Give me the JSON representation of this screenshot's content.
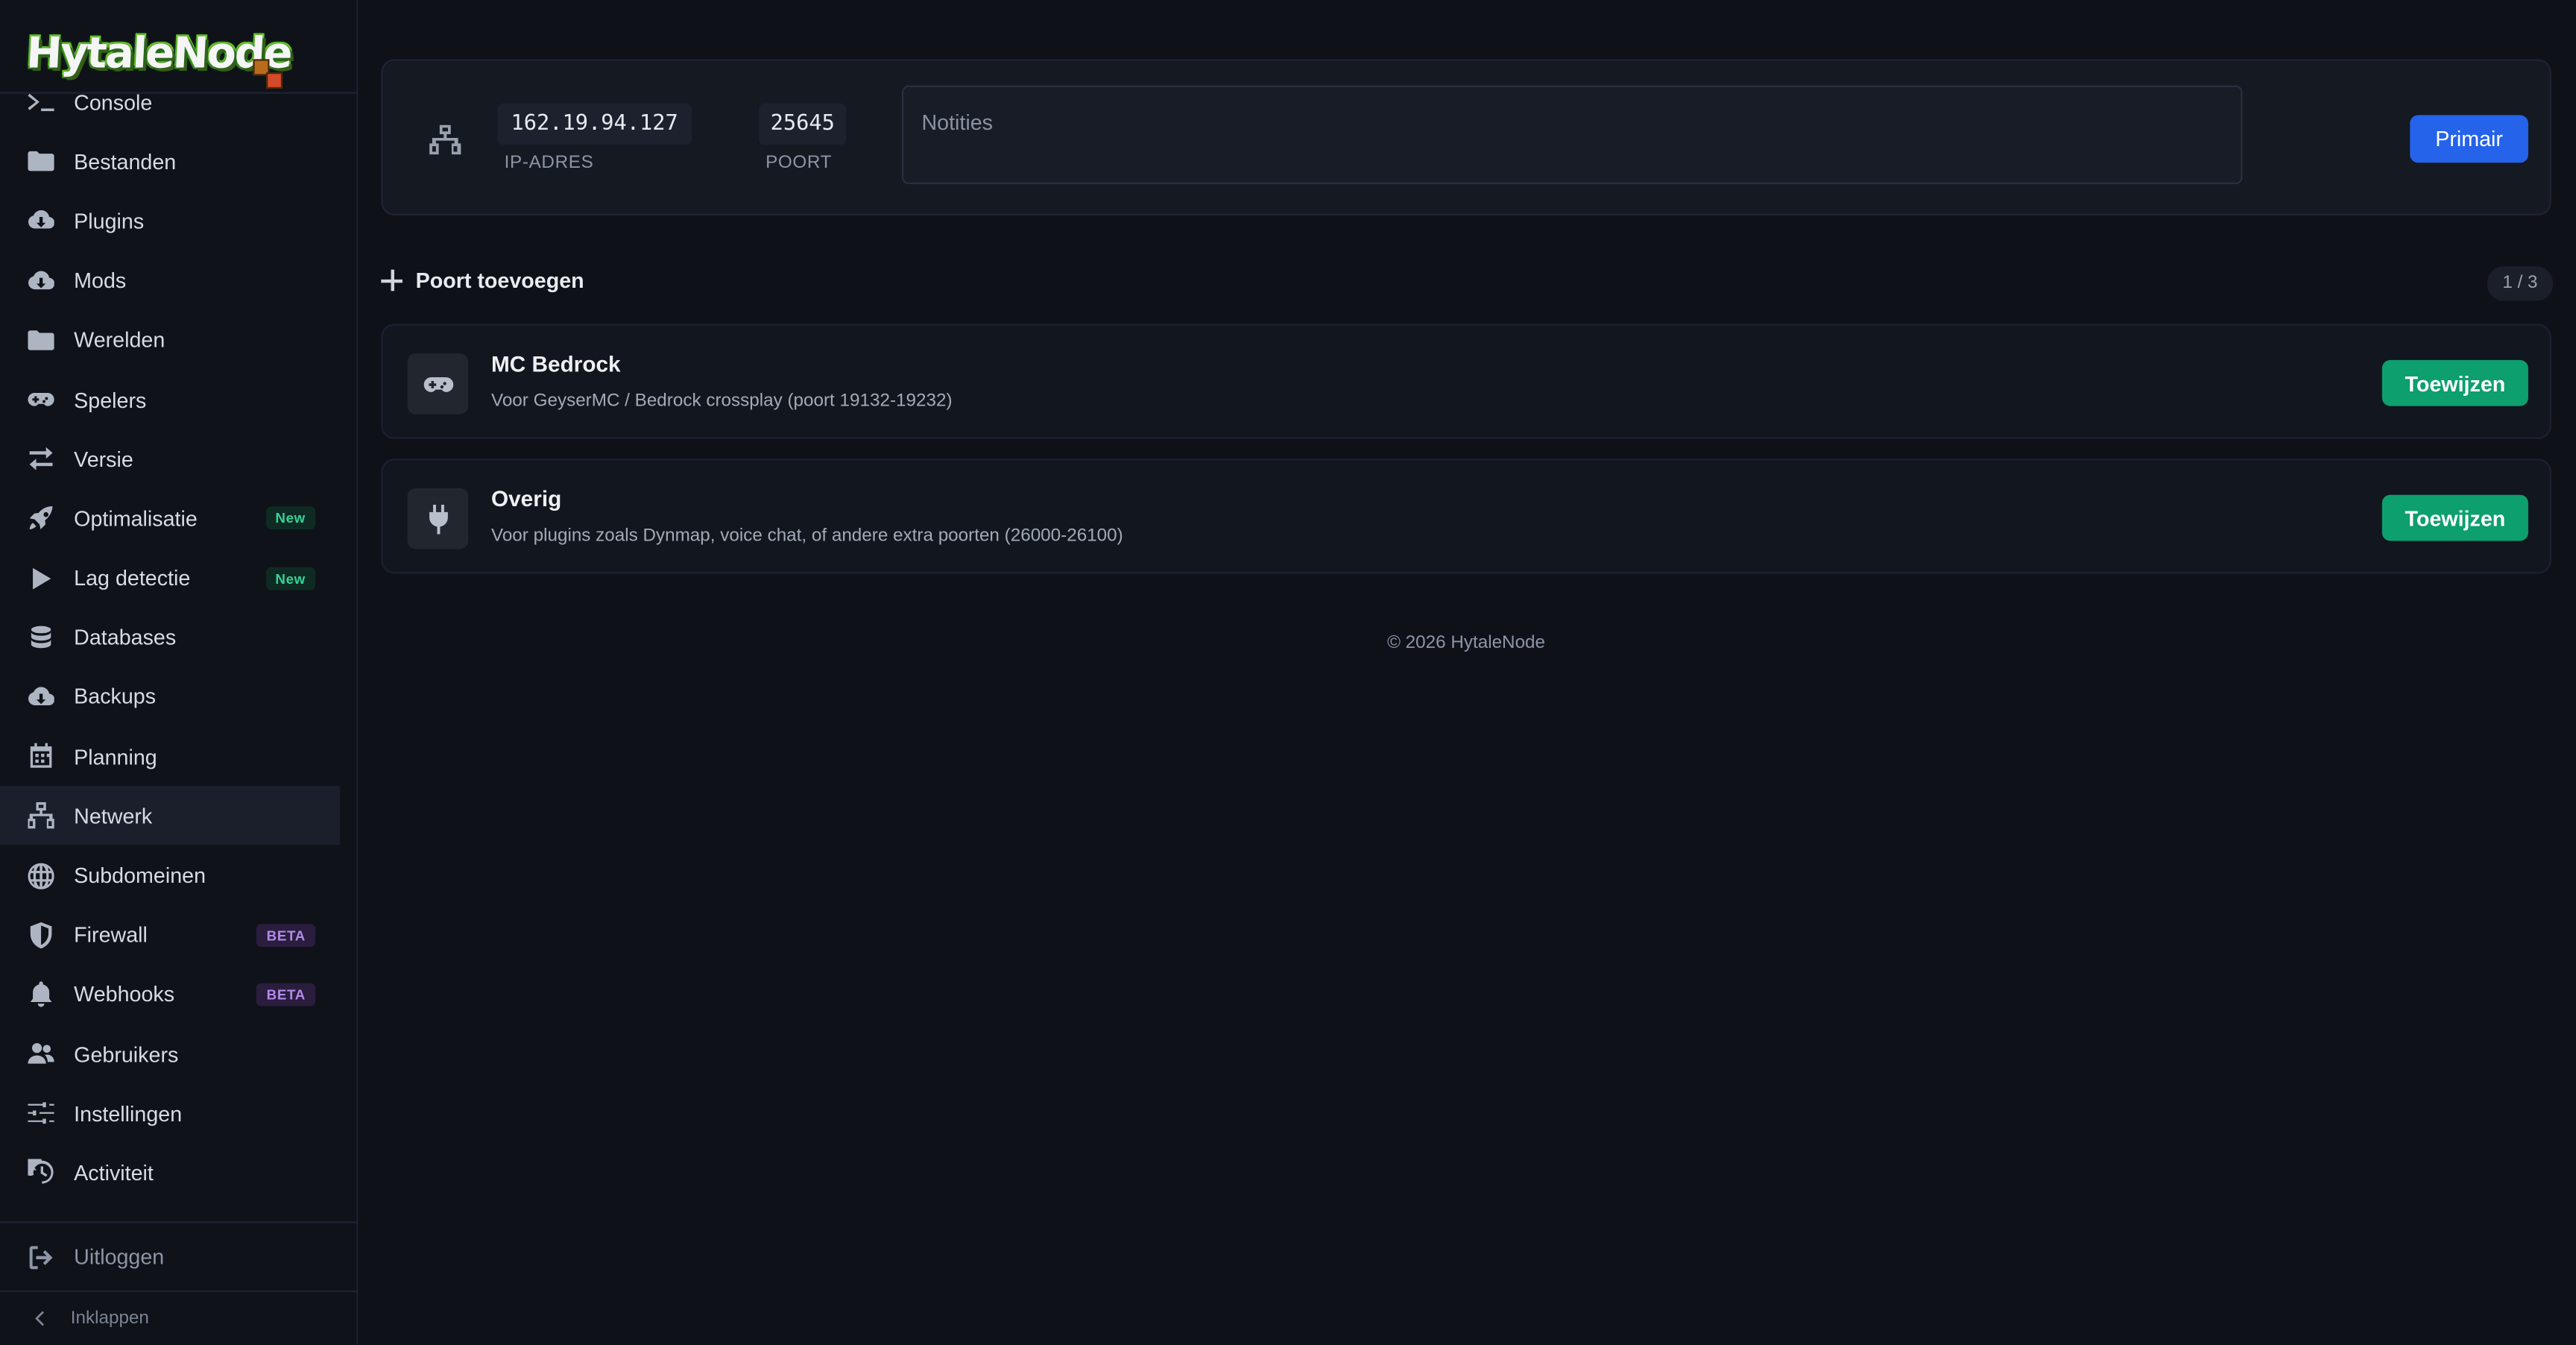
{
  "brand": {
    "name": "HytaleNode"
  },
  "sidebar": {
    "items": [
      {
        "label": "Console",
        "icon": "terminal-icon"
      },
      {
        "label": "Bestanden",
        "icon": "folder-icon"
      },
      {
        "label": "Plugins",
        "icon": "cloud-download-icon"
      },
      {
        "label": "Mods",
        "icon": "cloud-download-icon"
      },
      {
        "label": "Werelden",
        "icon": "folder-icon"
      },
      {
        "label": "Spelers",
        "icon": "gamepad-icon"
      },
      {
        "label": "Versie",
        "icon": "swap-icon"
      },
      {
        "label": "Optimalisatie",
        "icon": "rocket-icon",
        "badge": "New"
      },
      {
        "label": "Lag detectie",
        "icon": "play-icon",
        "badge": "New"
      },
      {
        "label": "Databases",
        "icon": "database-icon"
      },
      {
        "label": "Backups",
        "icon": "cloud-download-icon"
      },
      {
        "label": "Planning",
        "icon": "calendar-icon"
      },
      {
        "label": "Netwerk",
        "icon": "network-icon",
        "active": true
      },
      {
        "label": "Subdomeinen",
        "icon": "globe-icon"
      },
      {
        "label": "Firewall",
        "icon": "shield-icon",
        "badge": "BETA"
      },
      {
        "label": "Webhooks",
        "icon": "bell-icon",
        "badge": "BETA"
      },
      {
        "label": "Gebruikers",
        "icon": "users-icon"
      },
      {
        "label": "Instellingen",
        "icon": "sliders-icon"
      },
      {
        "label": "Activiteit",
        "icon": "history-icon"
      }
    ],
    "logout": "Uitloggen",
    "collapse": "Inklappen"
  },
  "primary_allocation": {
    "ip": "162.19.94.127",
    "ip_label": "IP-ADRES",
    "port": "25645",
    "port_label": "POORT",
    "notes_placeholder": "Notities",
    "primary_button": "Primair"
  },
  "ports": {
    "add_label": "Poort toevoegen",
    "counter": "1 / 3",
    "cards": [
      {
        "title": "MC Bedrock",
        "desc": "Voor GeyserMC / Bedrock crossplay (poort 19132-19232)",
        "icon": "gamepad-icon",
        "button": "Toewijzen"
      },
      {
        "title": "Overig",
        "desc": "Voor plugins zoals Dynmap, voice chat, of andere extra poorten (26000-26100)",
        "icon": "plug-icon",
        "button": "Toewijzen"
      }
    ]
  },
  "footer": {
    "text": "© 2026 HytaleNode"
  },
  "colors": {
    "background": "#0e1118",
    "primary_button": "#2563eb",
    "assign_button": "#0d9f6e",
    "badge_new": "#34d399",
    "badge_beta": "#b38be8"
  }
}
